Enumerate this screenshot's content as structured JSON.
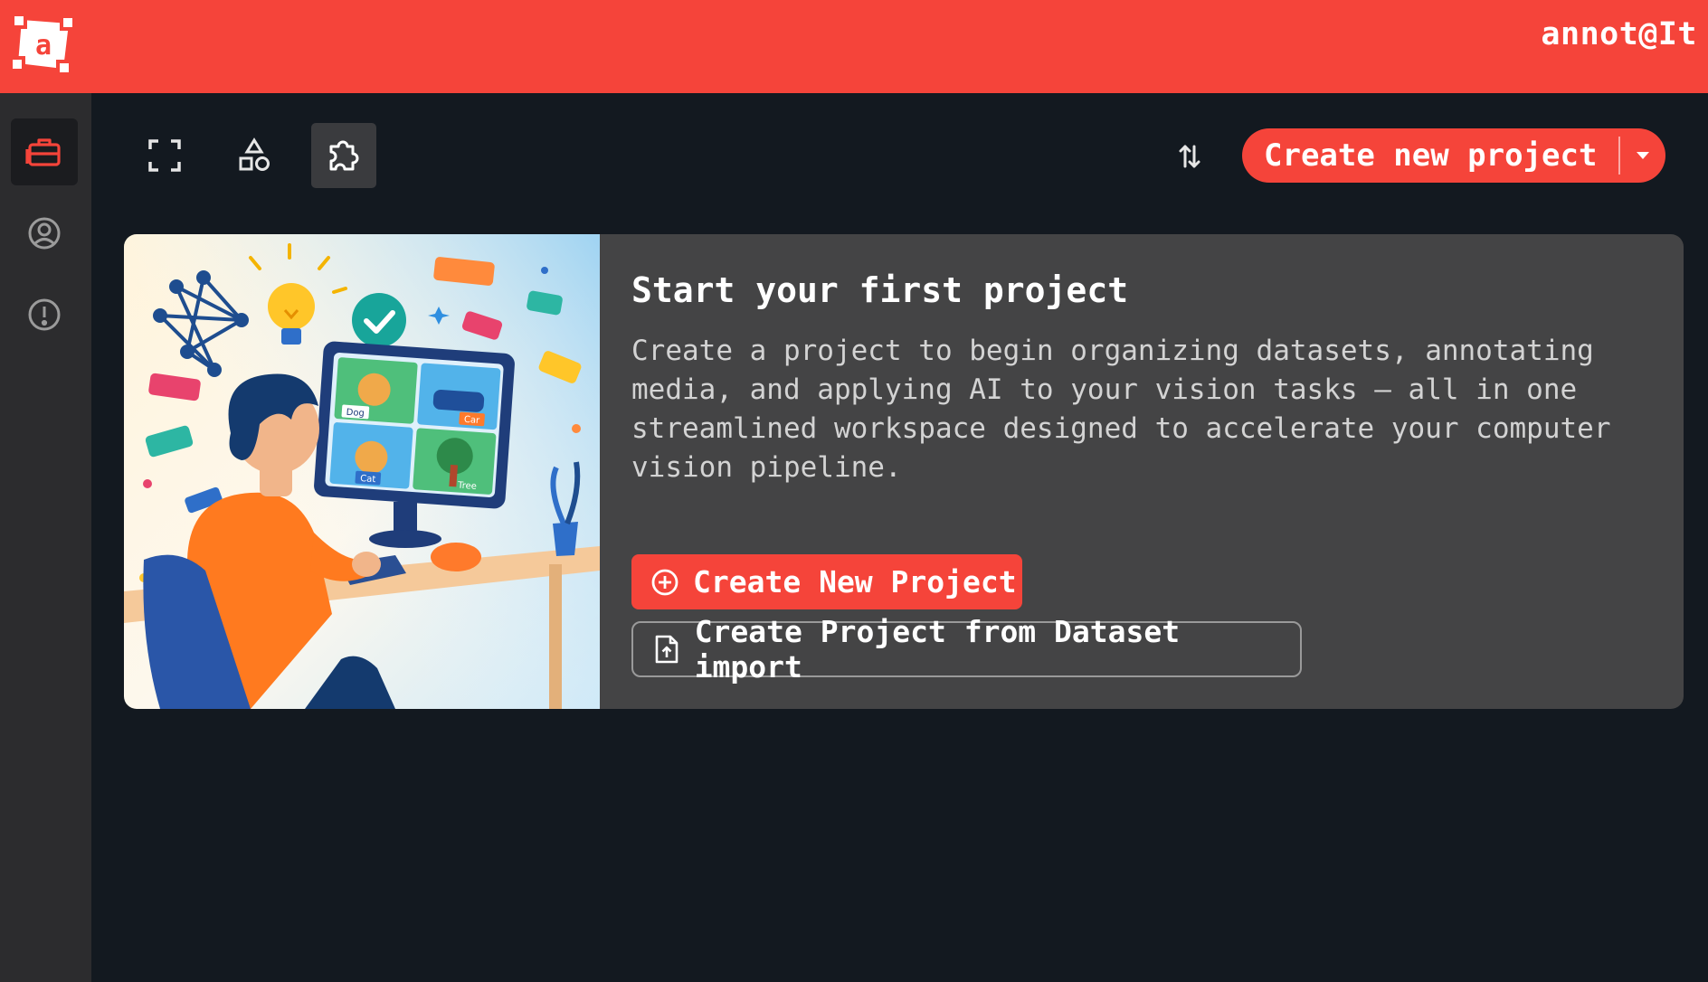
{
  "header": {
    "app_title": "annot@It",
    "logo_letter": "a",
    "accent_color": "#f5443a"
  },
  "sidebar": {
    "items": [
      {
        "icon": "briefcase-icon",
        "active": true
      },
      {
        "icon": "user-circle-icon",
        "active": false
      },
      {
        "icon": "alert-circle-icon",
        "active": false
      }
    ]
  },
  "toolbar": {
    "tools": [
      {
        "icon": "fullscreen-icon",
        "active": false
      },
      {
        "icon": "shapes-icon",
        "active": false
      },
      {
        "icon": "puzzle-icon",
        "active": true
      }
    ],
    "sort_icon": "sort-icon",
    "create_button_label": "Create new project",
    "create_dropdown_icon": "caret-down-icon"
  },
  "empty_state": {
    "title": "Start your first project",
    "description": "Create a project to begin organizing datasets, annotating media, and applying AI to your vision tasks — all in one streamlined workspace designed to accelerate your computer vision pipeline.",
    "primary_button_label": "Create New Project",
    "primary_button_icon": "plus-circle-icon",
    "secondary_button_label": "Create Project from Dataset import",
    "secondary_button_icon": "file-upload-icon",
    "illustration_labels": [
      "Dog",
      "Car",
      "Cat",
      "Tree"
    ]
  }
}
